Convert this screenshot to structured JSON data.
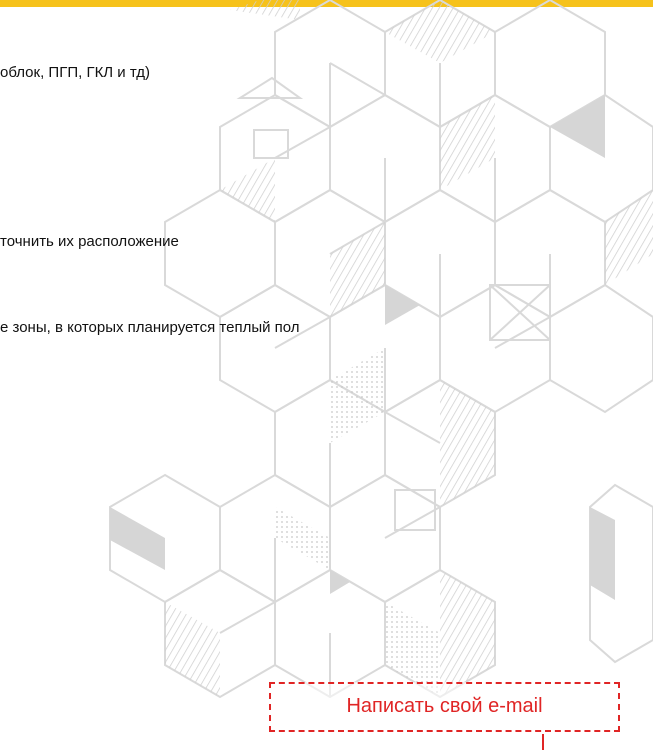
{
  "notes": [
    "облок, ПГП, ГКЛ и тд)",
    "точнить их расположение",
    "е зоны, в которых планируется теплый пол"
  ],
  "email_button": {
    "label": "Написать свой e-mail"
  },
  "colors": {
    "accent_bar": "#f6c21b",
    "button_red": "#e02525",
    "pattern_line": "#d9d9d9"
  }
}
